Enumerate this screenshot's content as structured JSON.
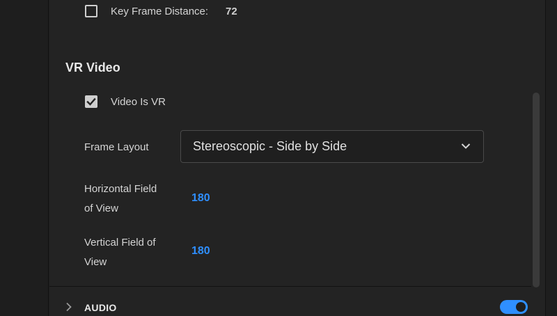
{
  "encoding": {
    "key_frame_distance_label": "Key Frame Distance:",
    "key_frame_distance_value": "72",
    "key_frame_distance_checked": false
  },
  "vr_video": {
    "section_title": "VR Video",
    "video_is_vr_label": "Video Is VR",
    "video_is_vr_checked": true,
    "frame_layout_label": "Frame Layout",
    "frame_layout_value": "Stereoscopic - Side by Side",
    "horizontal_fov_label_line1": "Horizontal Field",
    "horizontal_fov_label_line2": "of View",
    "horizontal_fov_value": "180",
    "vertical_fov_label_line1": "Vertical Field of",
    "vertical_fov_label_line2": "View",
    "vertical_fov_value": "180"
  },
  "audio_section": {
    "label": "AUDIO",
    "enabled": true
  },
  "colors": {
    "accent": "#2f8fff",
    "panel_bg": "#232323",
    "text": "#d4d4d4"
  },
  "icons": {
    "checkbox_check": "check-icon",
    "dropdown": "chevron-down-icon",
    "expand": "chevron-right-icon"
  }
}
